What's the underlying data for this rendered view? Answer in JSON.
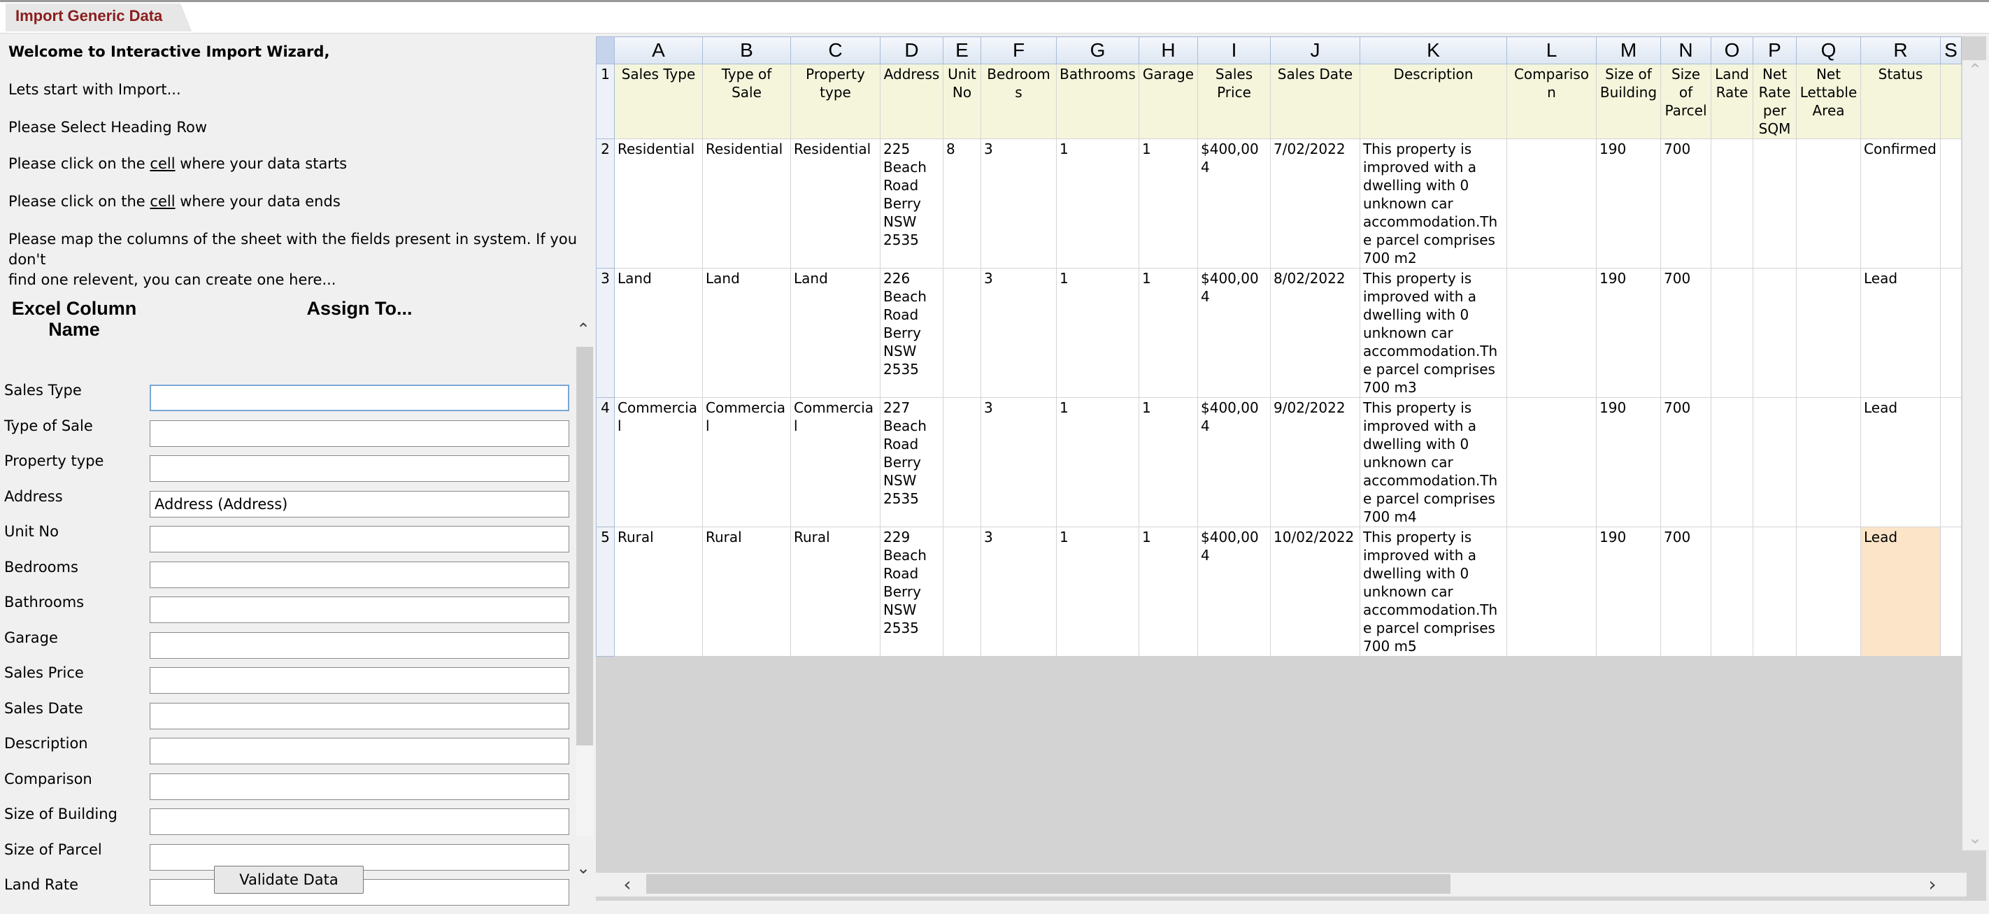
{
  "tab": {
    "label": "Import Generic Data"
  },
  "intro": {
    "welcome": "Welcome to Interactive Import Wizard,",
    "start": "Lets start with Import...",
    "heading_row": "Please Select Heading Row",
    "data_starts_pre": "Please click on the ",
    "data_starts_link": "cell",
    "data_starts_post": " where your data starts",
    "data_ends_pre": "Please click on the ",
    "data_ends_link": "cell",
    "data_ends_post": " where your data ends",
    "map_line1": "Please map the columns of the sheet with the fields present in system. If you don't",
    "map_line2": "find one relevent, you can create one here..."
  },
  "mapping": {
    "header_excel": "Excel Column Name",
    "header_assign": "Assign To...",
    "rows": [
      {
        "label": "Sales Type",
        "value": ""
      },
      {
        "label": "Type of Sale",
        "value": ""
      },
      {
        "label": "Property type",
        "value": ""
      },
      {
        "label": "Address",
        "value": "Address (Address)"
      },
      {
        "label": "Unit No",
        "value": ""
      },
      {
        "label": "Bedrooms",
        "value": ""
      },
      {
        "label": "Bathrooms",
        "value": ""
      },
      {
        "label": "Garage",
        "value": ""
      },
      {
        "label": "Sales Price",
        "value": ""
      },
      {
        "label": "Sales Date",
        "value": ""
      },
      {
        "label": "Description",
        "value": ""
      },
      {
        "label": "Comparison",
        "value": ""
      },
      {
        "label": "Size of Building",
        "value": ""
      },
      {
        "label": "Size of Parcel",
        "value": ""
      },
      {
        "label": "Land Rate",
        "value": ""
      }
    ]
  },
  "validate_label": "Validate Data",
  "grid": {
    "column_letters": [
      "A",
      "B",
      "C",
      "D",
      "E",
      "F",
      "G",
      "H",
      "I",
      "J",
      "K",
      "L",
      "M",
      "N",
      "O",
      "P",
      "Q",
      "R",
      "S"
    ],
    "row_numbers": [
      "1",
      "2",
      "3",
      "4",
      "5"
    ],
    "header_cells": [
      "Sales Type",
      "Type of Sale",
      "Property type",
      "Address",
      "Unit No",
      "Bedrooms",
      "Bathrooms",
      "Garage",
      "Sales Price",
      "Sales Date",
      "Description",
      "Comparison",
      "Size of Building",
      "Size of Parcel",
      "Land Rate",
      "Net Rate per SQM",
      "Net Lettable Area",
      "Status",
      ""
    ],
    "rows": [
      [
        "Residential",
        "Residential",
        "Residential",
        "225 Beach Road Berry NSW 2535",
        "8",
        "3",
        "1",
        "1",
        "$400,004",
        "7/02/2022",
        "This property is improved with a dwelling with 0 unknown car accommodation.The parcel comprises 700 m2",
        "",
        "190",
        "700",
        "",
        "",
        "",
        "Confirmed",
        ""
      ],
      [
        "Land",
        "Land",
        "Land",
        "226 Beach Road Berry NSW 2535",
        "",
        "3",
        "1",
        "1",
        "$400,004",
        "8/02/2022",
        "This property is improved with a dwelling with 0 unknown car accommodation.The parcel comprises 700 m3",
        "",
        "190",
        "700",
        "",
        "",
        "",
        "Lead",
        ""
      ],
      [
        "Commercial",
        "Commercial",
        "Commercial",
        "227 Beach Road Berry NSW 2535",
        "",
        "3",
        "1",
        "1",
        "$400,004",
        "9/02/2022",
        "This property is improved with a dwelling with 0 unknown car accommodation.The parcel comprises 700 m4",
        "",
        "190",
        "700",
        "",
        "",
        "",
        "Lead",
        ""
      ],
      [
        "Rural",
        "Rural",
        "Rural",
        "229 Beach Road Berry NSW 2535",
        "",
        "3",
        "1",
        "1",
        "$400,004",
        "10/02/2022",
        "This property is improved with a dwelling with 0 unknown car accommodation.The parcel comprises 700 m5",
        "",
        "190",
        "700",
        "",
        "",
        "",
        "Lead",
        ""
      ]
    ]
  },
  "icons": {
    "scroll_up": "chevron-up-icon",
    "scroll_down": "chevron-down-icon",
    "scroll_left": "chevron-left-icon",
    "scroll_right": "chevron-right-icon"
  },
  "colors": {
    "tab_text": "#8b1c1c",
    "header_row_bg": "#f5f5dc",
    "highlight_cell": "#fce4c8",
    "active_border": "#7aa7d6"
  }
}
